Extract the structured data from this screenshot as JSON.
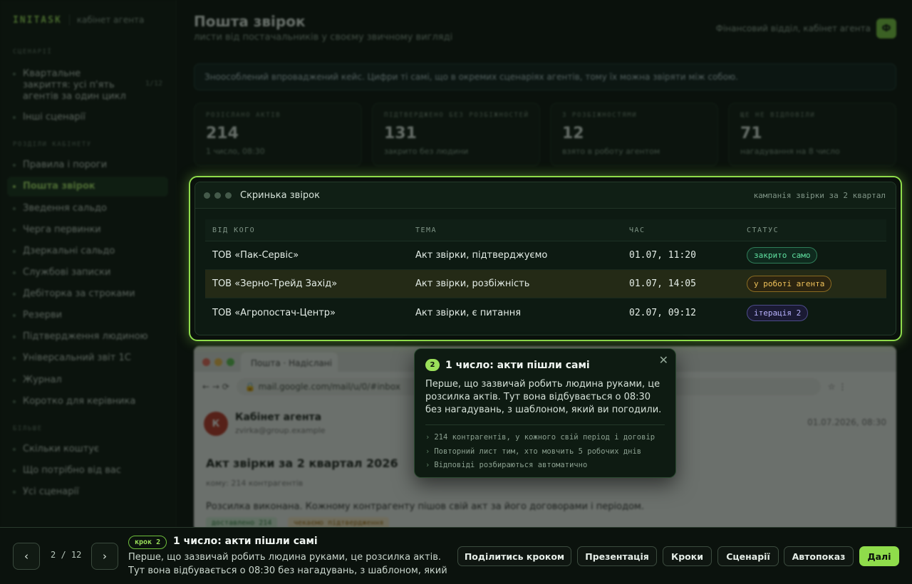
{
  "sidebar": {
    "brand": "INITASK",
    "brand_sub": "кабінет агента",
    "section_scenarios": "СЦЕНАРІЇ",
    "scenario_main": "Квартальне закриття: усі п'ять агентів за один цикл",
    "scenario_main_count": "1/12",
    "scenario_other": "Інші сценарії",
    "section_cabinet": "РОЗДІЛИ КАБІНЕТУ",
    "items": [
      {
        "label": "Правила і пороги"
      },
      {
        "label": "Пошта звірок",
        "active": true
      },
      {
        "label": "Зведення сальдо"
      },
      {
        "label": "Черга первинки"
      },
      {
        "label": "Дзеркальні сальдо"
      },
      {
        "label": "Службові записки"
      },
      {
        "label": "Дебіторка за строками"
      },
      {
        "label": "Резерви"
      },
      {
        "label": "Підтвердження людиною"
      },
      {
        "label": "Універсальний звіт 1С"
      },
      {
        "label": "Журнал"
      },
      {
        "label": "Коротко для керівника"
      }
    ],
    "section_more": "БІЛЬШЕ",
    "more_items": [
      {
        "label": "Скільки коштує"
      },
      {
        "label": "Що потрібно від вас"
      },
      {
        "label": "Усі сценарії"
      }
    ]
  },
  "header": {
    "title": "Пошта звірок",
    "subtitle": "листи від постачальників у своєму звичному вигляді",
    "context": "Фінансовий відділ, кабінет агента",
    "badge": "Ф"
  },
  "banner": "Зноособлений впроваджений кейс. Цифри ті самі, що в окремих сценаріях агентів, тому їх можна звіряти між собою.",
  "stats": [
    {
      "label": "РОЗІСЛАНО АКТІВ",
      "value": "214",
      "note": "1 число, 08:30"
    },
    {
      "label": "ПІДТВЕРДЖЕНО БЕЗ РОЗБІЖНОСТЕЙ",
      "value": "131",
      "note": "закрито без людини"
    },
    {
      "label": "З РОЗБІЖНОСТЯМИ",
      "value": "12",
      "note": "взято в роботу агентом"
    },
    {
      "label": "ЩЕ НЕ ВІДПОВІЛИ",
      "value": "71",
      "note": "нагадування на 8 число"
    }
  ],
  "inbox": {
    "title": "Скринька звірок",
    "meta": "кампанія звірки за 2 квартал",
    "columns": [
      "ВІД КОГО",
      "ТЕМА",
      "ЧАС",
      "СТАТУС"
    ],
    "rows": [
      {
        "from": "ТОВ «Пак-Сервіс»",
        "subject": "Акт звірки, підтверджуємо",
        "time": "01.07, 11:20",
        "status": "закрито само",
        "status_color": "#5fe0a0"
      },
      {
        "from": "ТОВ «Зерно-Трейд Захід»",
        "subject": "Акт звірки, розбіжність",
        "time": "01.07, 14:05",
        "status": "у роботі агента",
        "status_color": "#f0c25a"
      },
      {
        "from": "ТОВ «Агропостач-Центр»",
        "subject": "Акт звірки, є питання",
        "time": "02.07, 09:12",
        "status": "ітерація 2",
        "status_color": "#b9b3ff"
      }
    ]
  },
  "mail": {
    "tab": "Пошта · Надіслані",
    "url": "mail.google.com/mail/u/0/#inbox",
    "avatar": "К",
    "from": "Кабінет агента",
    "address": "zvirka@group.example",
    "date": "01.07.2026, 08:30",
    "subject": "Акт звірки за 2 квартал 2026",
    "to": "кому: 214 контрагентів",
    "body": "Розсилка виконана. Кожному контрагенту пішов свій акт за його договорами і періодом.",
    "chip_delivered": "доставлено 214",
    "chip_waiting": "чекаємо підтвердження"
  },
  "tooltip": {
    "num": "2",
    "title": "1 число: акти пішли самі",
    "text": "Перше, що зазвичай робить людина руками, це розсилка актів. Тут вона відбувається о 08:30 без нагадувань, з шаблоном, який ви погодили.",
    "points": [
      "214 контрагентів, у кожного свій період і договір",
      "Повторний лист тим, хто мовчить 5 робочих днів",
      "Відповіді розбираються автоматично"
    ]
  },
  "bottom": {
    "page": "2 / 12",
    "step": "крок 2",
    "title": "1 число: акти пішли самі",
    "text": "Перше, що зазвичай робить людина руками, це розсилка актів. Тут вона відбувається о 08:30 без нагадувань, з шаблоном, який ви…",
    "buttons": {
      "share": "Поділитись кроком",
      "presentation": "Презентація",
      "steps": "Кроки",
      "scenarios": "Сценарії",
      "autoplay": "Автопоказ",
      "next": "Далі"
    }
  },
  "colors": {
    "accent": "#8fdc4b",
    "background": "#0a110c"
  }
}
